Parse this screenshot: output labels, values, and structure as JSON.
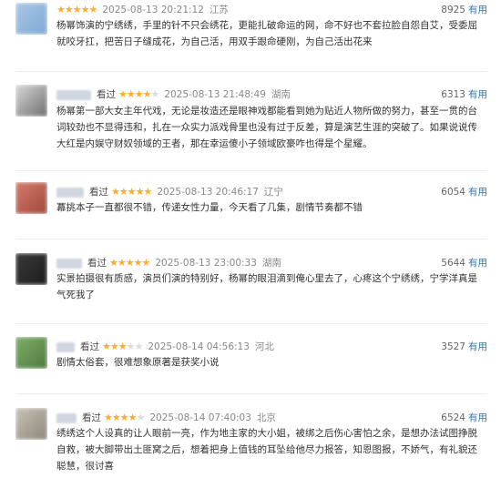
{
  "reviews": [
    {
      "status": "",
      "rating": 5,
      "time": "2025-08-13 20:21:12",
      "location": "江苏",
      "votes": "8925",
      "useful_label": "有用",
      "content": "杨幂饰演的宁绣绣，手里的针不只会绣花，更能扎破命运的网，命不好也不套拉脸自怨自艾，受委屈就咬牙扛，把苦日子缝成花，为自己活，用双手跟命硬刚，为自己活出花来",
      "avatar_colors": [
        "#a9c7e6",
        "#7fa9d4"
      ]
    },
    {
      "status": "看过",
      "rating": 4,
      "time": "2025-08-13 21:48:49",
      "location": "湖南",
      "votes": "6313",
      "useful_label": "有用",
      "content": "杨幂第一部大女主年代戏，无论是妆造还是眼神戏都能看到她为贴近人物所做的努力，甚至一贯的台词较劲也不显得违和，扎在一众实力派戏骨里也没有过于反差，算是演艺生涯的突破了。如果说说传大红是内娱守财奴领域的王者，那在幸运傻小子领域欧豪咋也得是个星耀。",
      "avatar_colors": [
        "#d9d9d9",
        "#6e6e6e"
      ]
    },
    {
      "status": "看过",
      "rating": 5,
      "time": "2025-08-13 20:46:17",
      "location": "辽宁",
      "votes": "6054",
      "useful_label": "有用",
      "content": "冪挑本子一直都很不错，传递女性力量，今天看了几集，剧情节奏都不错",
      "avatar_colors": [
        "#d77a6b",
        "#9c4a3c"
      ]
    },
    {
      "status": "看过",
      "rating": 5,
      "time": "2025-08-13 23:00:33",
      "location": "湖南",
      "votes": "5644",
      "useful_label": "有用",
      "content": "实景拍摄很有质感，演员们演的特别好，杨幂的眼泪滴到俺心里去了，心疼这个宁绣绣，宁学洋真是气死我了",
      "avatar_colors": [
        "#3a3a3a",
        "#1c1c1c"
      ]
    },
    {
      "status": "看过",
      "rating": 3,
      "time": "2025-08-14 04:56:13",
      "location": "河北",
      "votes": "3527",
      "useful_label": "有用",
      "content": "剧情太俗套，很难想象原著是获奖小说",
      "avatar_colors": [
        "#7fae6a",
        "#4c7a3e"
      ]
    },
    {
      "status": "看过",
      "rating": 4,
      "time": "2025-08-14 07:40:03",
      "location": "北京",
      "votes": "6524",
      "useful_label": "有用",
      "content": "绣绣这个人设真的让人眼前一亮，作为地主家的大小姐，被绑之后伤心害怕之余，是想办法试图挣脱自救，被大脚带出土匪窝之后，想着把身上值钱的耳坠给他尽力报答，知恩图报，不娇气，有礼貌还聪慧，很讨喜",
      "avatar_colors": [
        "#c9c4b8",
        "#8d8678"
      ]
    }
  ]
}
